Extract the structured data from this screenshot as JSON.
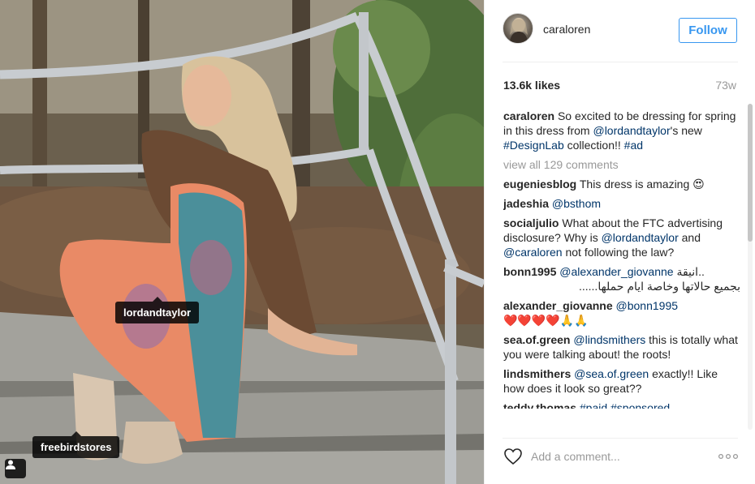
{
  "post": {
    "username": "caraloren",
    "follow_label": "Follow",
    "likes": "13.6k likes",
    "age": "73w",
    "tags": [
      {
        "label": "lordandtaylor"
      },
      {
        "label": "freebirdstores"
      }
    ]
  },
  "caption": {
    "user": "caraloren",
    "text_1": "So excited to be dressing for spring in this dress from ",
    "mention": "@lordandtaylor",
    "text_2": "'s new ",
    "hashtag_1": "#DesignLab",
    "text_3": " collection!! ",
    "hashtag_2": "#ad"
  },
  "view_all": "view all 129 comments",
  "comments": [
    {
      "user": "eugeniesblog",
      "text": "This dress is amazing 😍"
    },
    {
      "user": "jadeshia",
      "mention": "@bsthom"
    },
    {
      "user": "socialjulio",
      "text_1": "What about the FTC advertising disclosure? Why is ",
      "mention_1": "@lordandtaylor",
      "text_2": " and ",
      "mention_2": "@caraloren",
      "text_3": " not following the law?"
    },
    {
      "user": "bonn1995",
      "mention": "@alexander_giovanne",
      "text_1": " انيقة..",
      "text_2": "بجميع حالاتها وخاصة ايام حملها......"
    },
    {
      "user": "alexander_giovanne",
      "mention": "@bonn1995",
      "text": "❤️❤️❤️❤️🙏🙏"
    },
    {
      "user": "sea.of.green",
      "mention": "@lindsmithers",
      "text": " this is totally what you were talking about! the roots!"
    },
    {
      "user": "lindsmithers",
      "mention": "@sea.of.green",
      "text": " exactly!! Like how does it look so great??"
    },
    {
      "user": "teddy.thomas",
      "text": "#paid #sponsored"
    }
  ],
  "add_comment_placeholder": "Add a comment...",
  "icons": {
    "heart": "heart-icon",
    "more": "more-options-icon",
    "user_tag": "user-tag-icon"
  },
  "colors": {
    "follow_blue": "#3897f0",
    "link_blue": "#003569",
    "muted_gray": "#999999"
  }
}
